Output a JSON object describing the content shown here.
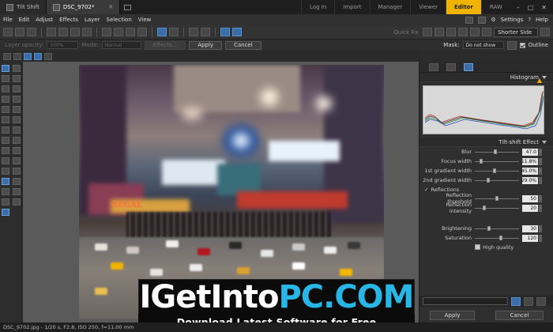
{
  "tabs": [
    {
      "label": "Tilt Shift",
      "active": false
    },
    {
      "label": "DSC_9702*",
      "active": true
    }
  ],
  "modes": [
    "Log In",
    "Import",
    "Manager",
    "Viewer",
    "Editor",
    "RAW"
  ],
  "active_mode": "Editor",
  "menu": [
    "File",
    "Edit",
    "Adjust",
    "Effects",
    "Layer",
    "Selection",
    "View"
  ],
  "menubar_right": {
    "settings_label": "Settings",
    "help_label": "Help"
  },
  "toolbar": {
    "zoom_value": "100%",
    "quick_fix_label": "Quick Fix",
    "view_fit": "Shorter Side"
  },
  "options_bar": {
    "layer_opacity_label": "Layer opacity:",
    "layer_opacity_value": "100%",
    "mode_label": "Mode:",
    "mode_value": "Normal",
    "effects_label": "Effects...",
    "apply_label": "Apply",
    "cancel_label": "Cancel",
    "mask_label": "Mask:",
    "mask_value": "Do not show",
    "outline_label": "Outline"
  },
  "photo_sign": "SEGAL",
  "watermark": {
    "part1": "IGetInto",
    "part2": "PC.COM",
    "tagline": "Download Latest Software for Free"
  },
  "histogram": {
    "title": "Histogram"
  },
  "effect": {
    "title": "Tilt-shift Effect",
    "params": [
      {
        "label": "Blur",
        "value": "47.0",
        "level": 0.47
      },
      {
        "label": "Focus width",
        "value": "11.8%",
        "level": 0.12
      },
      {
        "label": "1st gradient width",
        "value": "45.0%",
        "level": 0.45
      },
      {
        "label": "2nd gradient width",
        "value": "29.0%",
        "level": 0.29
      }
    ],
    "reflections_label": "Reflections",
    "reflection_params": [
      {
        "label": "Reflection threshold",
        "value": "50",
        "level": 0.5
      },
      {
        "label": "Reflection intensity",
        "value": "20",
        "level": 0.2
      }
    ],
    "color_params": [
      {
        "label": "Brightening",
        "value": "30",
        "level": 0.3
      },
      {
        "label": "Saturation",
        "value": "120",
        "level": 0.6
      }
    ],
    "high_quality_label": "High quality"
  },
  "panel_buttons": {
    "apply_label": "Apply",
    "cancel_label": "Cancel"
  },
  "status": "DSC_9702.jpg - 1/20 s, F2.8, ISO 250, f=11.00 mm"
}
